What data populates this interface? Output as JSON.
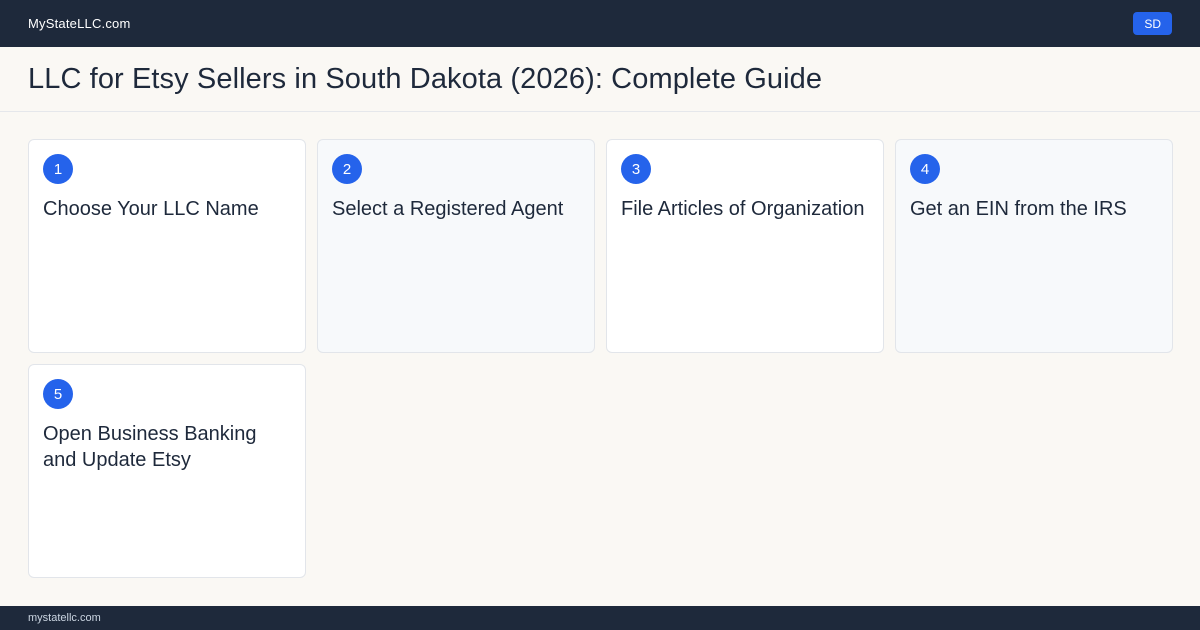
{
  "header": {
    "brand": "MyStateLLC.com",
    "state_badge": "SD"
  },
  "page": {
    "title": "LLC for Etsy Sellers in South Dakota (2026): Complete Guide"
  },
  "steps": [
    {
      "number": "1",
      "title": "Choose Your LLC Name"
    },
    {
      "number": "2",
      "title": "Select a Registered Agent"
    },
    {
      "number": "3",
      "title": "File Articles of Organization"
    },
    {
      "number": "4",
      "title": "Get an EIN from the IRS"
    },
    {
      "number": "5",
      "title": "Open Business Banking and Update Etsy"
    }
  ],
  "footer": {
    "domain": "mystatellc.com"
  },
  "colors": {
    "navy": "#1e293b",
    "accent": "#2563eb",
    "background": "#faf8f4"
  }
}
